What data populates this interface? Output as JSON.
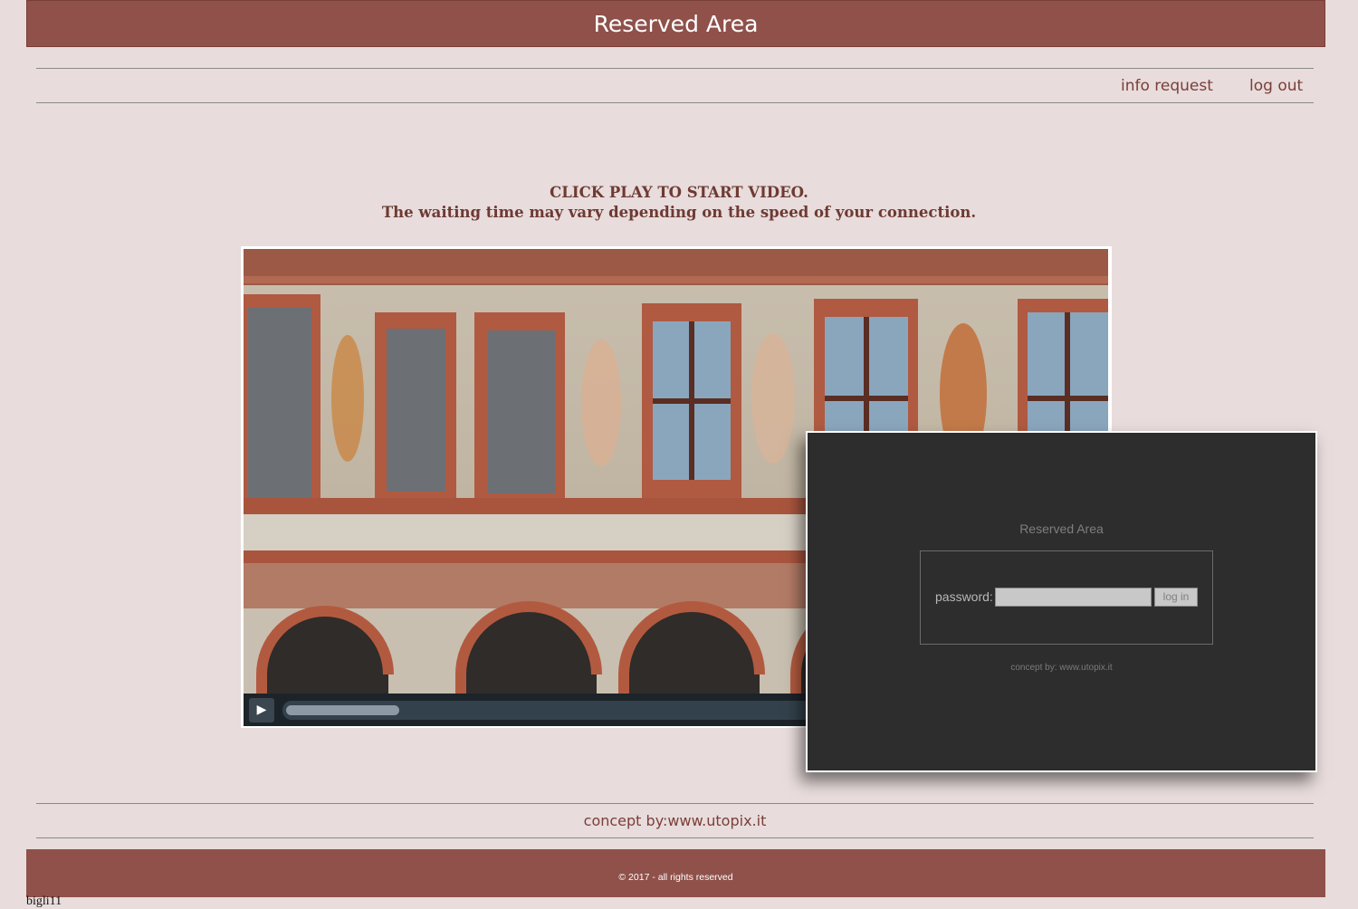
{
  "header": {
    "title": "Reserved Area"
  },
  "nav": {
    "info_request": "info request",
    "log_out": "log out"
  },
  "notice": {
    "line1": "CLICK PLAY TO START VIDEO.",
    "line2": "The waiting time may vary depending on the speed of your connection."
  },
  "video": {
    "buffered_fraction": 0.14
  },
  "login": {
    "title": "Reserved Area",
    "password_label": "password:",
    "password_value": "",
    "login_button": "log in",
    "credit": "concept by: www.utopix.it"
  },
  "footer": {
    "concept": "concept by:www.utopix.it",
    "copyright": "© 2017 - all rights reserved",
    "stray": "bigli11"
  },
  "colors": {
    "brand": "#8f514a",
    "background": "#e8dcdc",
    "text_accent": "#7a3f39"
  }
}
